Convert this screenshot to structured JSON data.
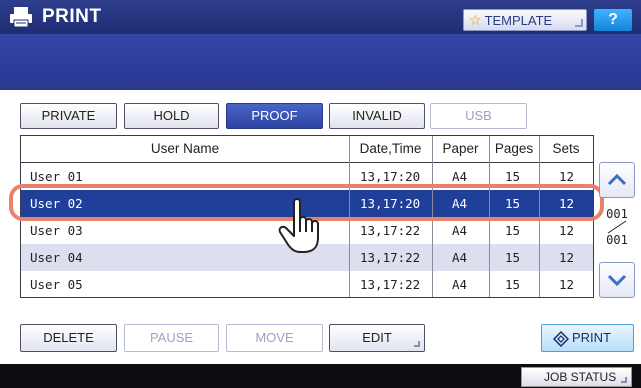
{
  "titlebar": {
    "title": "PRINT",
    "template_label": "TEMPLATE",
    "help_label": "?"
  },
  "tabs": [
    {
      "label": "PRIVATE",
      "state": "normal"
    },
    {
      "label": "HOLD",
      "state": "normal"
    },
    {
      "label": "PROOF",
      "state": "active"
    },
    {
      "label": "INVALID",
      "state": "normal"
    },
    {
      "label": "USB",
      "state": "disabled"
    }
  ],
  "table": {
    "headers": [
      "User Name",
      "Date,Time",
      "Paper",
      "Pages",
      "Sets"
    ],
    "rows": [
      {
        "user": "User 01",
        "time": "13,17:20",
        "paper": "A4",
        "pages": "15",
        "sets": "12"
      },
      {
        "user": "User 02",
        "time": "13,17:20",
        "paper": "A4",
        "pages": "15",
        "sets": "12",
        "selected": true
      },
      {
        "user": "User 03",
        "time": "13,17:22",
        "paper": "A4",
        "pages": "15",
        "sets": "12"
      },
      {
        "user": "User 04",
        "time": "13,17:22",
        "paper": "A4",
        "pages": "15",
        "sets": "12"
      },
      {
        "user": "User 05",
        "time": "13,17:22",
        "paper": "A4",
        "pages": "15",
        "sets": "12"
      }
    ]
  },
  "pager": {
    "current": "001",
    "total": "001"
  },
  "actions": {
    "delete": "DELETE",
    "pause": "PAUSE",
    "move": "MOVE",
    "edit": "EDIT",
    "print": "PRINT"
  },
  "statusbar": {
    "job_status": "JOB STATUS"
  },
  "colors": {
    "header_blue": "#2a3891",
    "selected_row": "#203f98",
    "highlight": "#e8826b",
    "alt_row": "#dcdfee"
  }
}
